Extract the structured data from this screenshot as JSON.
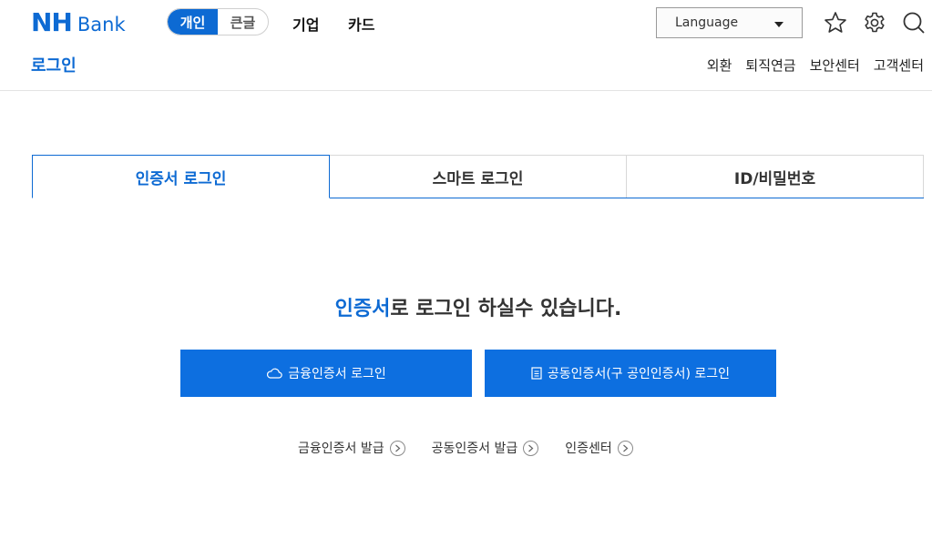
{
  "header": {
    "logo_nh": "NH",
    "logo_bank": "Bank",
    "segment": {
      "personal": "개인",
      "large_text": "큰글"
    },
    "nav": {
      "business": "기업",
      "card": "카드"
    },
    "language": "Language",
    "page_title": "로그인",
    "quicklinks": [
      "외환",
      "퇴직연금",
      "보안센터",
      "고객센터"
    ]
  },
  "tabs": [
    {
      "label": "인증서 로그인",
      "active": true
    },
    {
      "label": "스마트 로그인",
      "active": false
    },
    {
      "label": "ID/비밀번호",
      "active": false
    }
  ],
  "main": {
    "message_accent": "인증서",
    "message_rest": "로 로그인 하실수 있습니다.",
    "button_financial": "금융인증서 로그인",
    "button_joint": "공동인증서(구 공인인증서) 로그인",
    "links": [
      "금융인증서 발급",
      "공동인증서 발급",
      "인증센터"
    ]
  },
  "colors": {
    "accent": "#0d6ad3",
    "button": "#0d6fe0"
  }
}
